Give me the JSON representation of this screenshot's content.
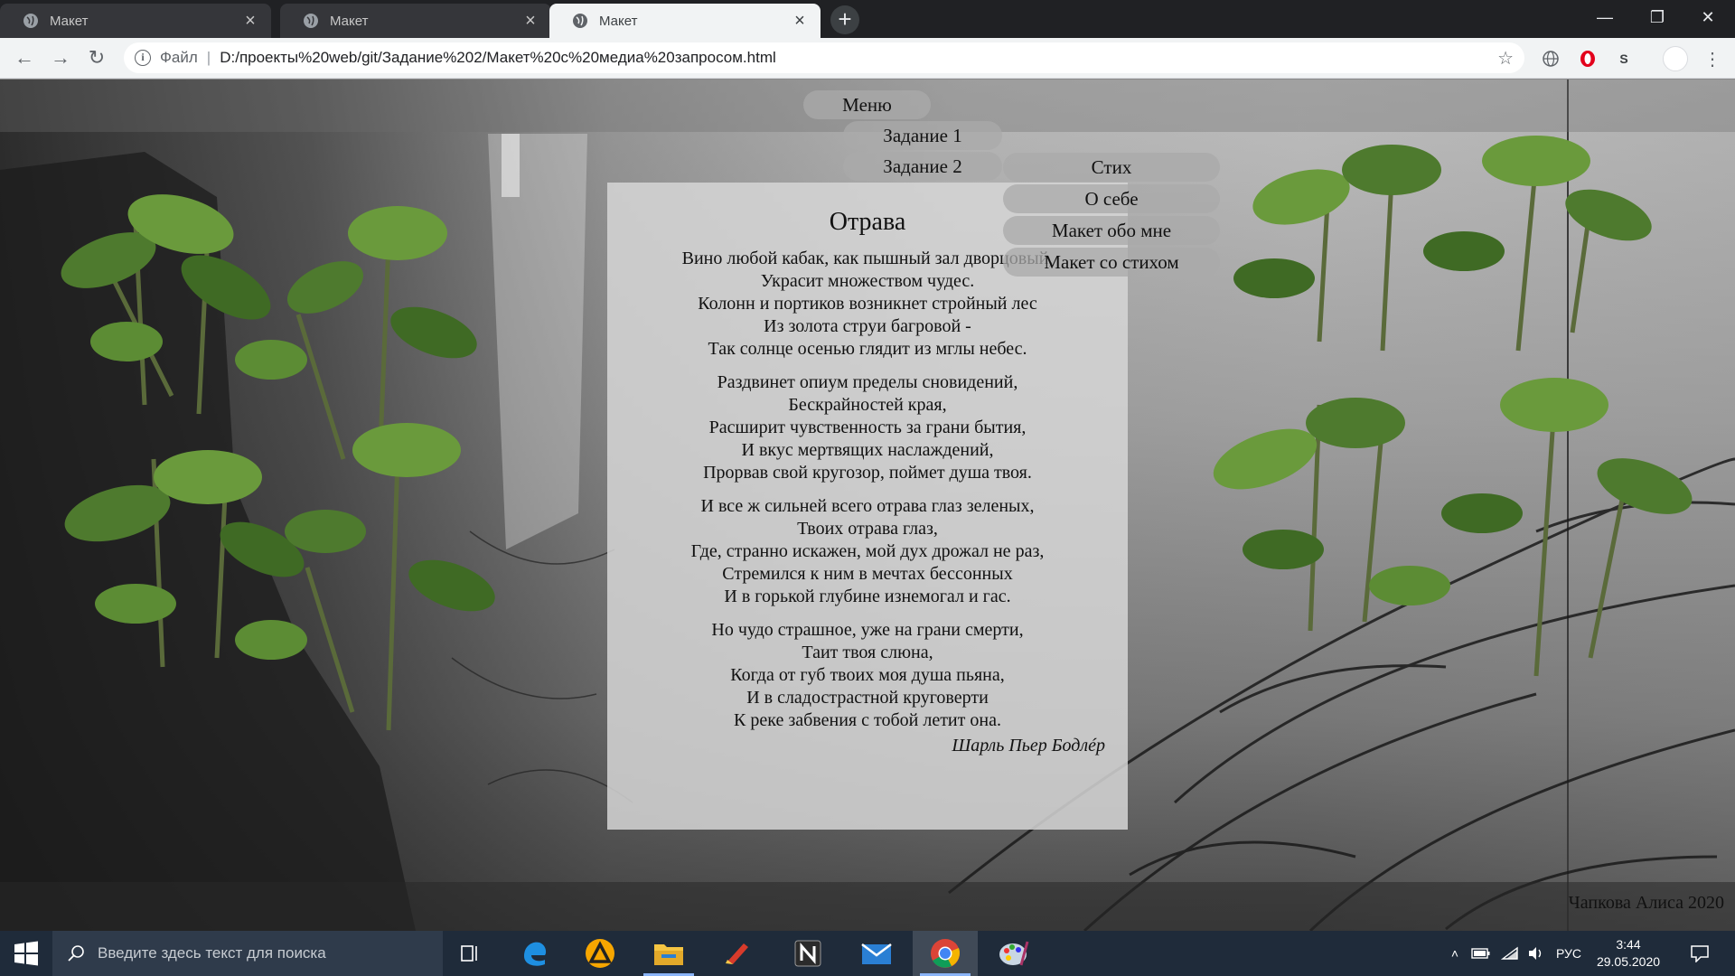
{
  "browser": {
    "tabs": [
      {
        "title": "Макет",
        "active": false
      },
      {
        "title": "Макет",
        "active": false
      },
      {
        "title": "Макет",
        "active": true
      }
    ],
    "new_tab_label": "+",
    "window_controls": {
      "minimize": "—",
      "restore": "❐",
      "close": "✕"
    },
    "address": {
      "scheme": "Файл",
      "url": "D:/проекты%20web/git/Задание%202/Макет%20с%20медиа%20запросом.html"
    },
    "extensions": [
      "globe-icon",
      "opera-icon",
      "s-icon",
      "profile-avatar",
      "menu-icon"
    ],
    "extension_label_s": "S"
  },
  "page": {
    "menu": {
      "main": "Меню",
      "items": [
        "Задание 1",
        "Задание 2"
      ],
      "submenu": [
        "Стих",
        "О себе",
        "Макет обо мне",
        "Макет со стихом"
      ]
    },
    "poem": {
      "title": "Отрава",
      "stanzas": [
        [
          "Вино любой кабак, как пышный зал дворцовый,",
          "Украсит множеством чудес.",
          "Колонн и портиков возникнет стройный лес",
          "Из золота струи багровой -",
          "Так солнце осенью глядит из мглы небес."
        ],
        [
          "Раздвинет опиум пределы сновидений,",
          "Бескрайностей края,",
          "Расширит чувственность за грани бытия,",
          "И вкус мертвящих наслаждений,",
          "Прорвав свой кругозор, поймет душа твоя."
        ],
        [
          "И все ж сильней всего отрава глаз зеленых,",
          "Твоих отрава глаз,",
          "Где, странно искажен, мой дух дрожал не раз,",
          "Стремился к ним в мечтах бессонных",
          "И в горькой глубине изнемогал и гас."
        ],
        [
          "Но чудо страшное, уже на грани смерти,",
          "Таит твоя слюна,",
          "Когда от губ твоих моя душа пьяна,",
          "И в сладострастной круговерти",
          "К реке забвения с тобой летит она."
        ]
      ],
      "author": "Шарль Пьер Бодлéр"
    },
    "copyright": "Чапкова Алиса 2020"
  },
  "taskbar": {
    "search_placeholder": "Введите здесь текст для поиска",
    "apps": [
      "task-view-icon",
      "edge-icon",
      "avast-icon",
      "file-explorer-icon",
      "ccleaner-icon",
      "notion-icon",
      "mail-icon",
      "chrome-icon",
      "paint-icon"
    ],
    "tray": {
      "language": "РУС",
      "time": "3:44",
      "date": "29.05.2020"
    }
  },
  "colors": {
    "tabbar": "#202124",
    "toolbar": "#f1f3f4",
    "taskbar": "#1f2b3a",
    "menu_button": "#aaaaaa",
    "poem_panel": "#d6d6d6"
  }
}
